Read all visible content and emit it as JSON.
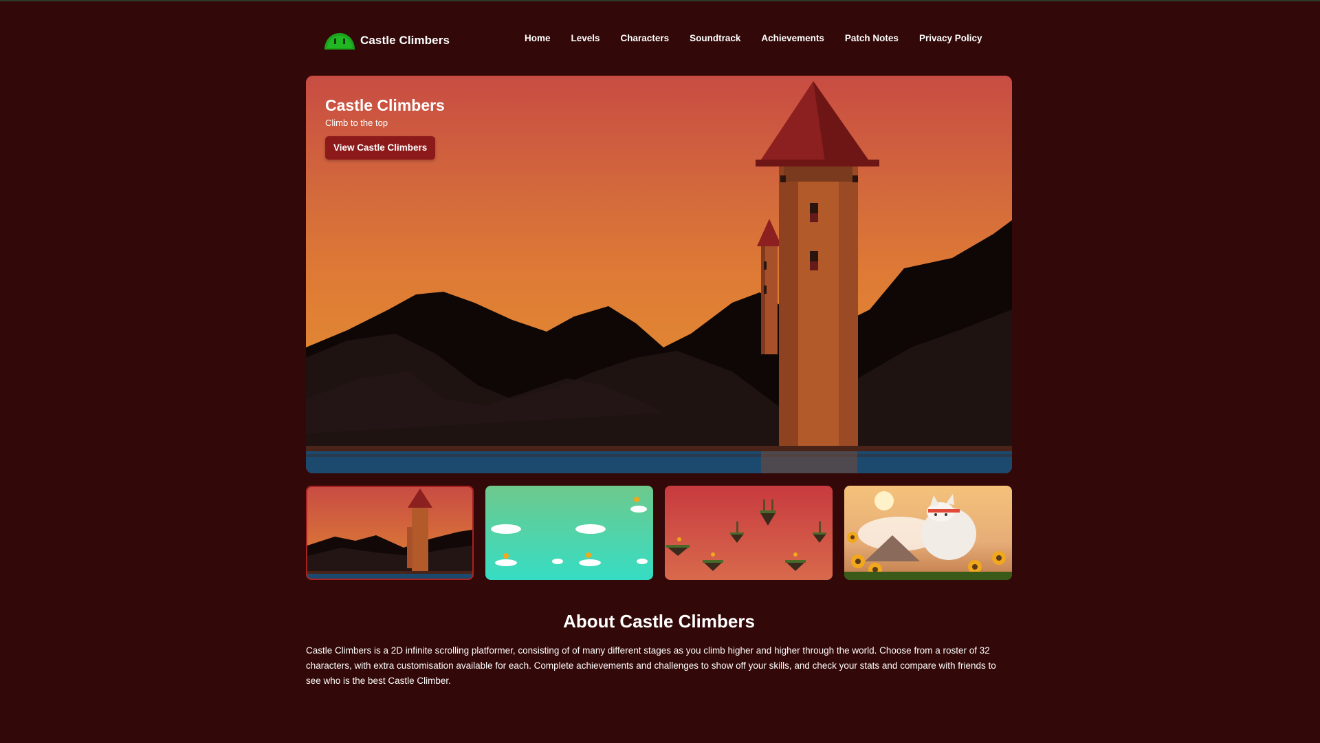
{
  "brand": {
    "name": "Castle Climbers",
    "logo_icon": "green-slime-icon",
    "accent_color": "#8c1a1a",
    "background_color": "#330808"
  },
  "nav": {
    "items": [
      {
        "label": "Home"
      },
      {
        "label": "Levels"
      },
      {
        "label": "Characters"
      },
      {
        "label": "Soundtrack"
      },
      {
        "label": "Achievements"
      },
      {
        "label": "Patch Notes"
      },
      {
        "label": "Privacy Policy"
      }
    ]
  },
  "hero": {
    "title": "Castle Climbers",
    "subtitle": "Climb to the top",
    "button_label": "View Castle Climbers"
  },
  "gallery": {
    "selected_index": 0,
    "thumbnails": [
      {
        "scene": "castle-tower-sunset"
      },
      {
        "scene": "cloud-platforms-sky"
      },
      {
        "scene": "floating-islands-red"
      },
      {
        "scene": "cat-character-sunflowers"
      }
    ]
  },
  "about": {
    "title": "About Castle Climbers",
    "text": "Castle Climbers is a 2D infinite scrolling platformer, consisting of of many different stages as you climb higher and higher through the world. Choose from a roster of 32 characters, with extra customisation available for each. Complete achievements and challenges to show off your skills, and check your stats and compare with friends to see who is the best Castle Climber."
  }
}
